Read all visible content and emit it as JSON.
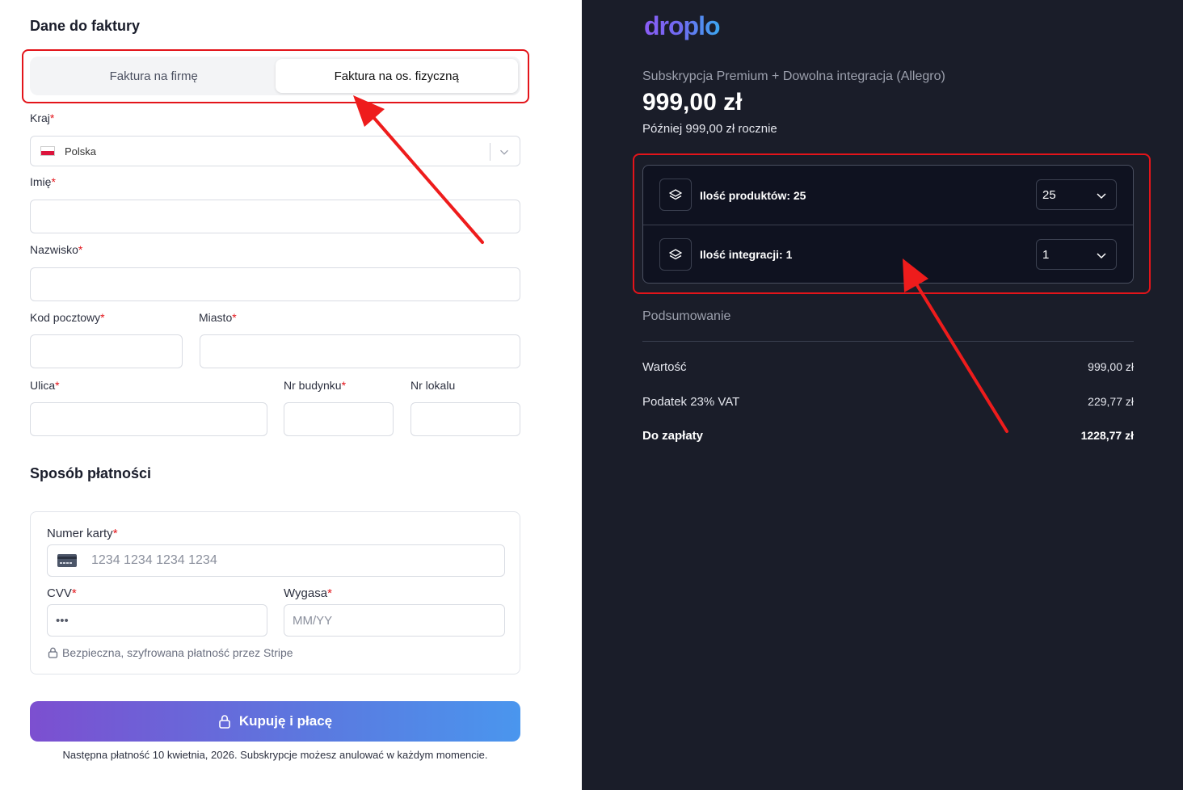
{
  "billing": {
    "title": "Dane do faktury",
    "tabs": [
      {
        "label": "Faktura na firmę",
        "active": false
      },
      {
        "label": "Faktura na os. fizyczną",
        "active": true
      }
    ],
    "country": {
      "label": "Kraj",
      "value": "Polska"
    },
    "first_name": {
      "label": "Imię",
      "value": ""
    },
    "last_name": {
      "label": "Nazwisko",
      "value": ""
    },
    "postal_code": {
      "label": "Kod pocztowy",
      "value": ""
    },
    "city": {
      "label": "Miasto",
      "value": ""
    },
    "street": {
      "label": "Ulica",
      "value": ""
    },
    "building_no": {
      "label": "Nr budynku",
      "value": ""
    },
    "apartment_no": {
      "label": "Nr lokalu",
      "value": ""
    },
    "required_mark": "*"
  },
  "payment": {
    "title": "Sposób płatności",
    "card_number": {
      "label": "Numer karty",
      "placeholder": "1234 1234 1234 1234"
    },
    "cvv": {
      "label": "CVV",
      "placeholder": "•••"
    },
    "expiry": {
      "label": "Wygasa",
      "placeholder": "MM/YY"
    },
    "secure_note": "Bezpieczna, szyfrowana płatność przez Stripe",
    "buy_button": "Kupuję i płacę",
    "footnote": "Następna płatność 10 kwietnia, 2026. Subskrypcje możesz anulować w każdym momencie."
  },
  "order": {
    "logo": "droplo",
    "plan_name": "Subskrypcja Premium + Dowolna integracja (Allegro)",
    "price": "999,00 zł",
    "later": "Później 999,00 zł rocznie",
    "options": [
      {
        "label": "Ilość produktów: 25",
        "value": "25"
      },
      {
        "label": "Ilość integracji: 1",
        "value": "1"
      }
    ],
    "summary_title": "Podsumowanie",
    "summary": [
      {
        "label": "Wartość",
        "value": "999,00 zł"
      },
      {
        "label": "Podatek 23% VAT",
        "value": "229,77 zł"
      },
      {
        "label": "Do zapłaty",
        "value": "1228,77 zł"
      }
    ]
  },
  "colors": {
    "accent_red": "#e3141a",
    "dark_bg": "#1a1d29",
    "button_gradient_start": "#7c4fd0",
    "button_gradient_end": "#4a96ee"
  }
}
